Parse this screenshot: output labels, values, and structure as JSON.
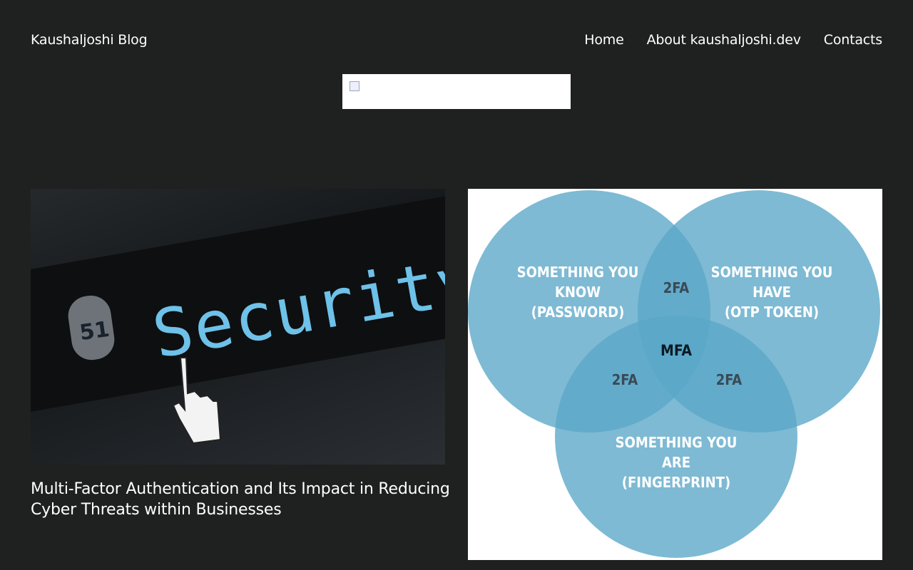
{
  "header": {
    "site_title": "Kaushaljoshi Blog",
    "nav": [
      "Home",
      "About kaushaljoshi.dev",
      "Contacts"
    ]
  },
  "posts": [
    {
      "title": "Multi-Factor Authentication and Its Impact in Reducing Cyber Threats within Businesses",
      "image_text": "Security",
      "badge_text": "51"
    },
    {
      "image_labels": {
        "know": [
          "SOMETHING YOU",
          "KNOW",
          "(PASSWORD)"
        ],
        "have": [
          "SOMETHING YOU",
          "HAVE",
          "(OTP TOKEN)"
        ],
        "are": [
          "SOMETHING YOU",
          "ARE",
          "(FINGERPRINT)"
        ],
        "overlap_top": "2FA",
        "overlap_left": "2FA",
        "overlap_right": "2FA",
        "center": "MFA"
      }
    }
  ],
  "colors": {
    "background": "#1f2020",
    "venn_fill": "#5aa6c8",
    "security_text": "#6ec1e8"
  }
}
